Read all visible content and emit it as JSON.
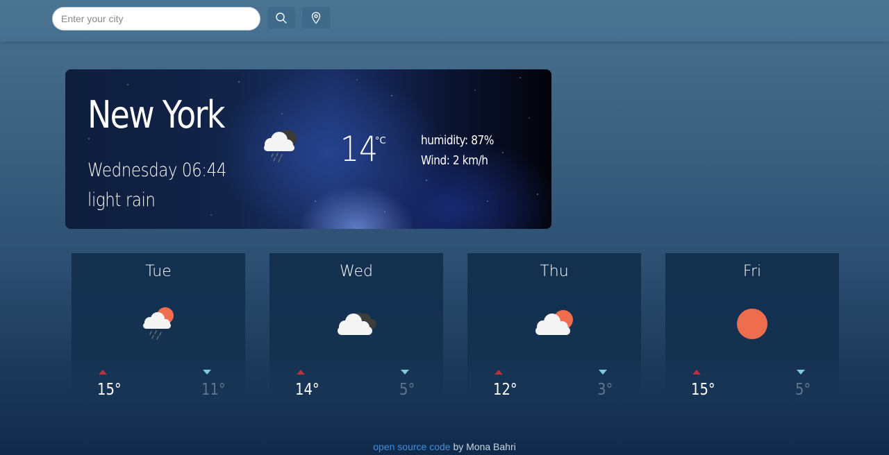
{
  "search": {
    "placeholder": "Enter your city"
  },
  "toolbar": {
    "search_icon": "search-icon",
    "location_icon": "location-pin-icon"
  },
  "current": {
    "city": "New York",
    "datetime": "Wednesday 06:44",
    "description": "light rain",
    "icon": "cloud-rain-dark-icon",
    "temperature": "14",
    "unit": "°C",
    "humidity": "humidity: 87%",
    "wind": "Wind: 2 km/h"
  },
  "forecast": [
    {
      "day": "Tue",
      "icon": "cloud-rain-sun-icon",
      "high": "15°",
      "low": "11°"
    },
    {
      "day": "Wed",
      "icon": "cloud-dark-icon",
      "high": "14°",
      "low": "5°"
    },
    {
      "day": "Thu",
      "icon": "cloud-sun-icon",
      "high": "12°",
      "low": "3°"
    },
    {
      "day": "Fri",
      "icon": "sun-icon",
      "high": "15°",
      "low": "5°"
    }
  ],
  "footer": {
    "link_text": "open source code",
    "by_text": " by Mona Bahri"
  },
  "colors": {
    "accent": "#3d8fe0",
    "high_arrow": "#b8323d",
    "low_arrow": "#7fc9da",
    "sun": "#ee6d4f"
  }
}
